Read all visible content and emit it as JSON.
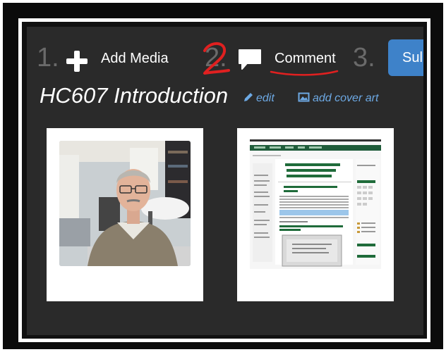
{
  "steps": [
    {
      "number": "1.",
      "label": "Add Media",
      "icon": "plus-icon"
    },
    {
      "number": "2.",
      "label": "Comment",
      "icon": "comment-icon"
    },
    {
      "number": "3.",
      "label": "Submit"
    }
  ],
  "annotation": {
    "digit": "2",
    "color": "#e02020"
  },
  "submit_button_label": "Sul",
  "page_title": "HC607 Introduction",
  "edit_link": "edit",
  "cover_link": "add cover art",
  "media": [
    {
      "kind": "photo",
      "icon": "person-photo"
    },
    {
      "kind": "document",
      "icon": "web-page-thumbnail",
      "doc_title": "Healthcare Operations Research - HC607 (HC607-5643_QS17)",
      "doc_heading": "HC607 Health Care Operations Research",
      "doc_link": "Get Started by Watching the Introduction Video"
    }
  ],
  "colors": {
    "accent": "#3e82c9",
    "link": "#6da9e4",
    "panel": "#2a2a2a",
    "annotation": "#e02020"
  }
}
